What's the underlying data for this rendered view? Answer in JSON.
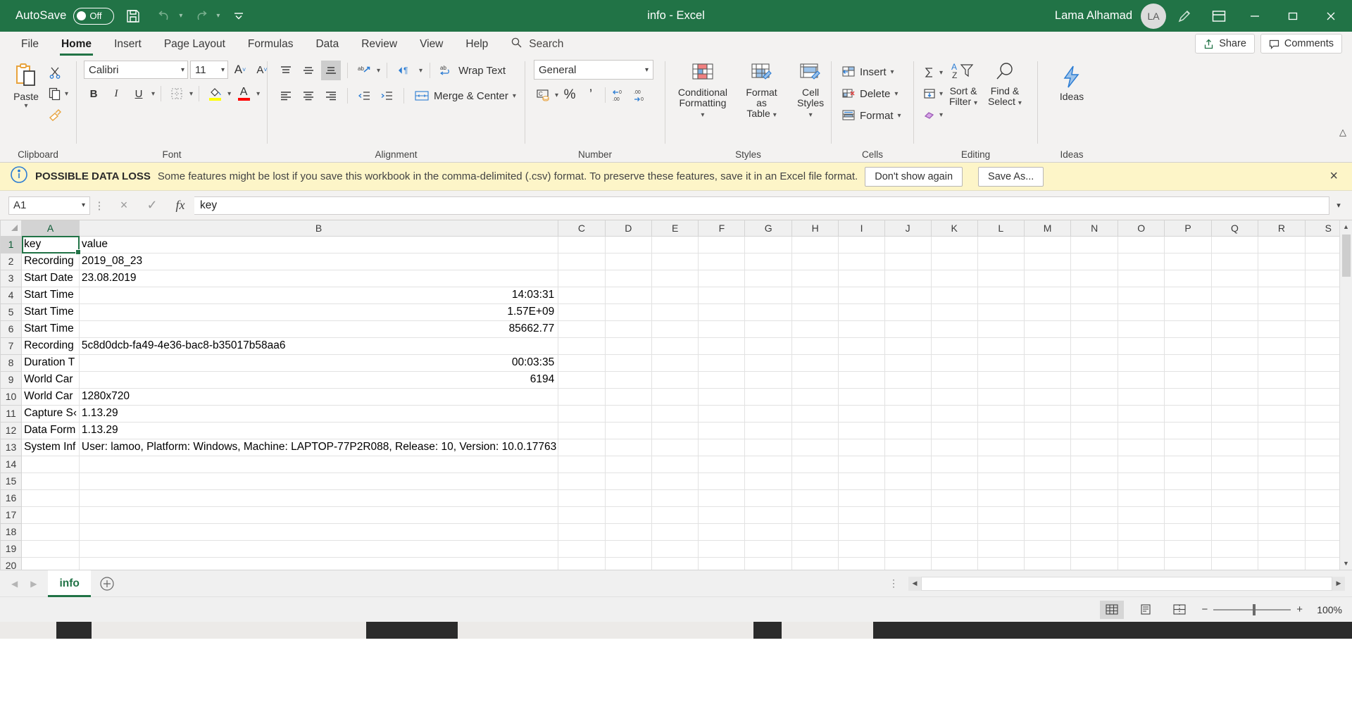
{
  "titlebar": {
    "autosave_label": "AutoSave",
    "autosave_state": "Off",
    "save_icon": "save-icon",
    "undo_icon": "undo-icon",
    "redo_icon": "redo-icon",
    "customize_icon": "customize-quick-access-icon",
    "document_title": "info  -  Excel",
    "user_name": "Lama Alhamad",
    "user_initials": "LA",
    "pen_icon": "pen-icon",
    "ribbon_display_icon": "ribbon-display-options-icon",
    "minimize": "minimize-icon",
    "restore": "restore-icon",
    "close": "close-icon",
    "brand_color": "#217346"
  },
  "tabs": [
    {
      "label": "File",
      "active": false
    },
    {
      "label": "Home",
      "active": true
    },
    {
      "label": "Insert",
      "active": false
    },
    {
      "label": "Page Layout",
      "active": false
    },
    {
      "label": "Formulas",
      "active": false
    },
    {
      "label": "Data",
      "active": false
    },
    {
      "label": "Review",
      "active": false
    },
    {
      "label": "View",
      "active": false
    },
    {
      "label": "Help",
      "active": false
    }
  ],
  "search": {
    "placeholder": "Search",
    "label": "Search"
  },
  "tabstrip_right": {
    "share_label": "Share",
    "comments_label": "Comments"
  },
  "ribbon": {
    "groups": [
      {
        "name": "Clipboard",
        "label": "Clipboard"
      },
      {
        "name": "Font",
        "label": "Font"
      },
      {
        "name": "Alignment",
        "label": "Alignment"
      },
      {
        "name": "Number",
        "label": "Number"
      },
      {
        "name": "Styles",
        "label": "Styles"
      },
      {
        "name": "Cells",
        "label": "Cells"
      },
      {
        "name": "Editing",
        "label": "Editing"
      },
      {
        "name": "Ideas",
        "label": "Ideas"
      }
    ],
    "clipboard": {
      "paste_label": "Paste",
      "cut_label": "Cut",
      "copy_label": "Copy",
      "format_painter_label": "Format Painter"
    },
    "font": {
      "font_name": "Calibri",
      "font_size": "11",
      "grow_label": "A",
      "shrink_label": "A",
      "bold": "B",
      "italic": "I",
      "underline": "U",
      "borders_label": "Borders",
      "fill_color_label": "Fill Color",
      "font_color_label": "Font Color"
    },
    "alignment": {
      "wrap_text": "Wrap Text",
      "merge_center": "Merge & Center",
      "orientation_label": "Orientation",
      "text_direction_label": "Text Direction"
    },
    "number": {
      "format": "General",
      "accounting_label": "Accounting Number Format",
      "percent": "%",
      "comma": "’",
      "increase_decimal_label": "Increase Decimal",
      "decrease_decimal_label": "Decrease Decimal"
    },
    "styles": {
      "conditional_formatting": "Conditional\nFormatting",
      "conditional_formatting_l1": "Conditional",
      "conditional_formatting_l2": "Formatting",
      "format_as_table_l1": "Format as",
      "format_as_table_l2": "Table",
      "cell_styles_l1": "Cell",
      "cell_styles_l2": "Styles"
    },
    "cells": {
      "insert": "Insert",
      "delete": "Delete",
      "format": "Format"
    },
    "editing": {
      "autosum_label": "AutoSum",
      "fill_label": "Fill",
      "clear_label": "Clear",
      "sort_filter_l1": "Sort &",
      "sort_filter_l2": "Filter",
      "find_select_l1": "Find &",
      "find_select_l2": "Select"
    },
    "ideas": {
      "label": "Ideas"
    }
  },
  "warning": {
    "icon": "info-icon",
    "title": "POSSIBLE DATA LOSS",
    "message": "Some features might be lost if you save this workbook in the comma-delimited (.csv) format. To preserve these features, save it in an Excel file format.",
    "dont_show_again": "Don't show again",
    "save_as": "Save As...",
    "close_icon": "close-icon",
    "bg_color": "#fdf5c8"
  },
  "formula_bar": {
    "name_box_value": "A1",
    "cancel_icon": "cancel-icon",
    "enter_icon": "enter-icon",
    "function_icon": "fx-icon",
    "formula_value": "key",
    "expand_icon": "chevron-down-icon"
  },
  "grid": {
    "columns": [
      "A",
      "B",
      "C",
      "D",
      "E",
      "F",
      "G",
      "H",
      "I",
      "J",
      "K",
      "L",
      "M",
      "N",
      "O",
      "P",
      "Q",
      "R",
      "S"
    ],
    "rows": [
      1,
      2,
      3,
      4,
      5,
      6,
      7,
      8,
      9,
      10,
      11,
      12,
      13,
      14,
      15,
      16,
      17,
      18,
      19,
      20
    ],
    "selected_cell": "A1",
    "cells": [
      {
        "row": 1,
        "a": "key",
        "b": "value",
        "b_align": "left",
        "overflow": false
      },
      {
        "row": 2,
        "a": "Recording",
        "b": "2019_08_23",
        "b_align": "left",
        "overflow": false
      },
      {
        "row": 3,
        "a": "Start Date",
        "b": "23.08.2019",
        "b_align": "left",
        "overflow": false
      },
      {
        "row": 4,
        "a": "Start Time",
        "b": "14:03:31",
        "b_align": "right",
        "overflow": false
      },
      {
        "row": 5,
        "a": "Start Time",
        "b": "1.57E+09",
        "b_align": "right",
        "overflow": false
      },
      {
        "row": 6,
        "a": "Start Time",
        "b": "85662.77",
        "b_align": "right",
        "overflow": false
      },
      {
        "row": 7,
        "a": "Recording",
        "b": "5c8d0dcb-fa49-4e36-bac8-b35017b58aa6",
        "b_align": "left",
        "overflow": true
      },
      {
        "row": 8,
        "a": "Duration T",
        "b": "00:03:35",
        "b_align": "right",
        "overflow": false
      },
      {
        "row": 9,
        "a": "World Car",
        "b": "6194",
        "b_align": "right",
        "overflow": false
      },
      {
        "row": 10,
        "a": "World Car",
        "b": "1280x720",
        "b_align": "left",
        "overflow": false
      },
      {
        "row": 11,
        "a": "Capture S‹",
        "b": "1.13.29",
        "b_align": "left",
        "overflow": false
      },
      {
        "row": 12,
        "a": "Data Form",
        "b": "1.13.29",
        "b_align": "left",
        "overflow": false
      },
      {
        "row": 13,
        "a": "System Inf",
        "b": "User: lamoo, Platform: Windows, Machine: LAPTOP-77P2R088, Release: 10, Version: 10.0.17763",
        "b_align": "left",
        "overflow": true
      }
    ]
  },
  "sheet_tabs": {
    "prev_icon": "previous-sheet-icon",
    "next_icon": "next-sheet-icon",
    "tabs": [
      {
        "label": "info",
        "active": true
      }
    ],
    "add_sheet_icon": "add-sheet-icon"
  },
  "status_bar": {
    "normal_view_icon": "normal-view-icon",
    "page_layout_icon": "page-layout-view-icon",
    "page_break_icon": "page-break-preview-icon",
    "zoom_out": "−",
    "zoom_in": "+",
    "zoom_level": "100%"
  }
}
